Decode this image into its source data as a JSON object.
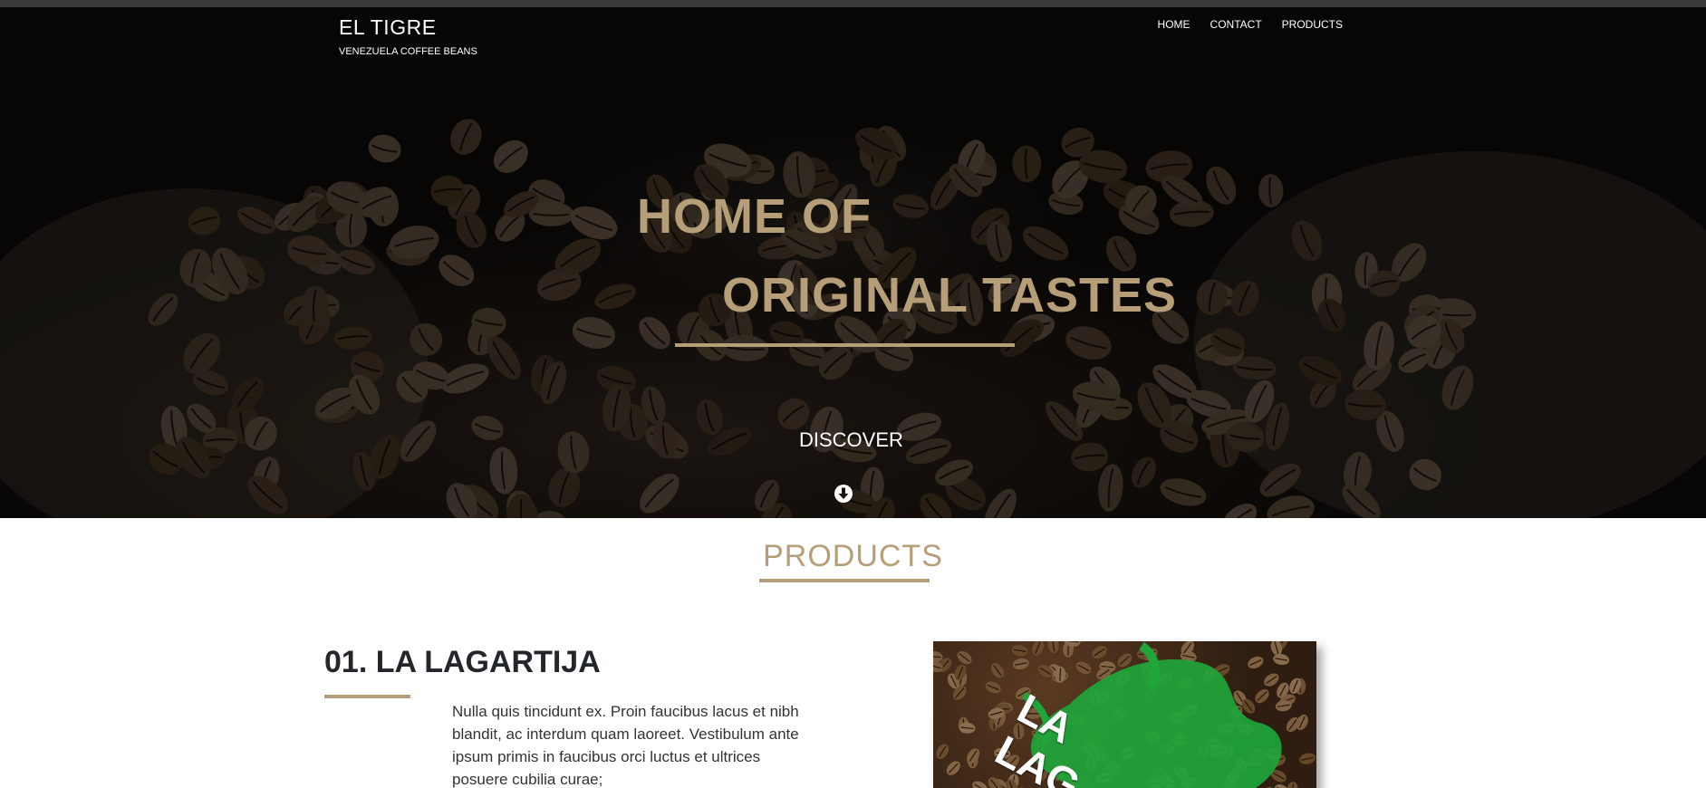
{
  "brand": {
    "title": "EL TIGRE",
    "subtitle": "VENEZUELA COFFEE BEANS"
  },
  "nav": {
    "items": [
      "HOME",
      "CONTACT",
      "PRODUCTS"
    ]
  },
  "hero": {
    "line1": "HOME OF",
    "line2": "ORIGINAL TASTES",
    "cta": "DISCOVER"
  },
  "products": {
    "section_title": "PRODUCTS",
    "items": [
      {
        "title": "01. LA LAGARTIJA",
        "description": "Nulla quis tincidunt ex. Proin faucibus lacus et nibh blandit, ac interdum quam laoreet. Vestibulum ante ipsum primis in faucibus orci luctus et ultrices posuere cubilia curae;",
        "image_text": "LA LAG"
      }
    ]
  },
  "icons": {
    "discover": "arrow-down-circle-icon"
  },
  "colors": {
    "accent": "#b59e78",
    "dark_text": "#23262b",
    "hero_bg": "#0b0a09",
    "label_green": "#1fa53a"
  }
}
